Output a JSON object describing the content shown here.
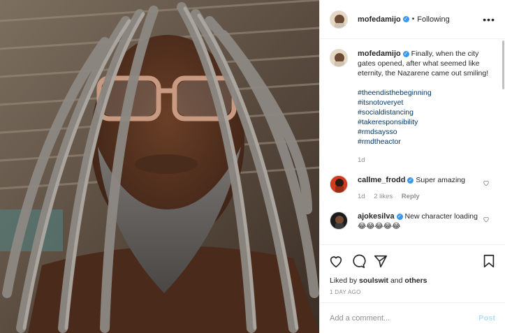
{
  "header": {
    "username": "mofedamijo",
    "dot": "•",
    "following": "Following",
    "more": "•••"
  },
  "caption": {
    "username": "mofedamijo",
    "text": "Finally, when the city gates opened, after what seemed like eternity, the Nazarene came out smiling!",
    "hashtags": [
      "#theendisthebeginning",
      "#itsnotoveryet",
      "#socialdistancing",
      "#takeresponsibility",
      "#rmdsaysso",
      "#rmdtheactor"
    ],
    "age": "1d"
  },
  "comments": [
    {
      "username": "callme_frodd",
      "text": "Super amazing",
      "age": "1d",
      "likes": "2 likes",
      "reply": "Reply"
    },
    {
      "username": "ajokesilva",
      "text": "New character loading😂😂😂😂😂"
    }
  ],
  "likes": {
    "prefix": "Liked by",
    "user": "soulswit",
    "and": "and",
    "others": "others"
  },
  "posted": "1 DAY AGO",
  "add_comment": {
    "placeholder": "Add a comment...",
    "post": "Post"
  },
  "colors": {
    "link": "#00376b",
    "verified": "#3897f0",
    "post_disabled": "#b2dffc"
  }
}
